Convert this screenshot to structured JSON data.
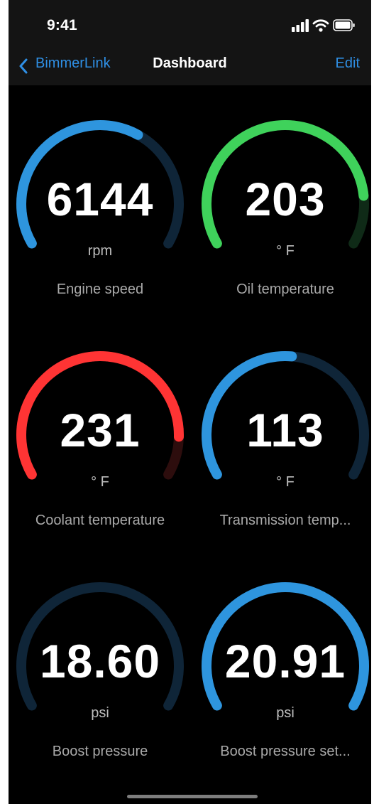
{
  "status_bar": {
    "time": "9:41"
  },
  "nav": {
    "back_label": "BimmerLink",
    "title": "Dashboard",
    "edit_label": "Edit"
  },
  "track_color": "#0f2538",
  "gauges": [
    {
      "value": "6144",
      "unit": "rpm",
      "label": "Engine speed",
      "fill": 0.62,
      "color": "#2e95de",
      "track": "#0f2538"
    },
    {
      "value": "203",
      "unit": "° F",
      "label": "Oil temperature",
      "fill": 0.85,
      "color": "#3fd25b",
      "track": "#0f2a17"
    },
    {
      "value": "231",
      "unit": "° F",
      "label": "Coolant temperature",
      "fill": 0.88,
      "color": "#ff3434",
      "track": "#2d0d0d"
    },
    {
      "value": "113",
      "unit": "° F",
      "label": "Transmission temp...",
      "fill": 0.52,
      "color": "#2e95de",
      "track": "#0f2538"
    },
    {
      "value": "18.60",
      "unit": "psi",
      "label": "Boost pressure",
      "fill": 0.0,
      "color": "#2e95de",
      "track": "#0f2538"
    },
    {
      "value": "20.91",
      "unit": "psi",
      "label": "Boost pressure set...",
      "fill": 1.0,
      "color": "#2e95de",
      "track": "#0f2538"
    }
  ]
}
